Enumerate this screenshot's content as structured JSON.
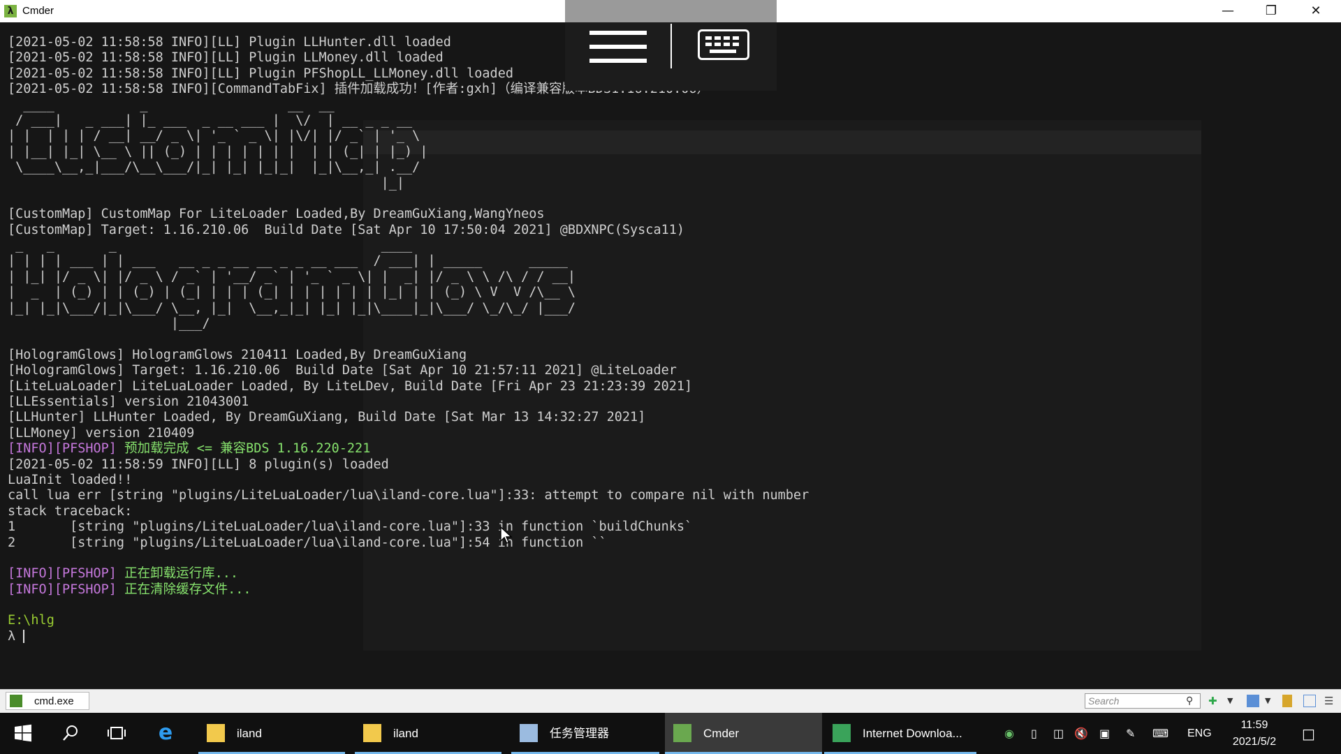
{
  "window": {
    "title": "Cmder",
    "icon": "lambda-icon",
    "controls": [
      "minimize-icon",
      "restore-icon",
      "close-icon"
    ]
  },
  "overlay_toolbar": {
    "icons": [
      "hamburger-menu-icon",
      "keyboard-icon"
    ]
  },
  "console": {
    "lines": [
      "[2021-05-02 11:58:58 INFO][LL] Plugin LLHunter.dll loaded",
      "[2021-05-02 11:58:58 INFO][LL] Plugin LLMoney.dll loaded",
      "[2021-05-02 11:58:58 INFO][LL] Plugin PFShopLL_LLMoney.dll loaded",
      "[2021-05-02 11:58:58 INFO][CommandTabFix] 插件加载成功！[作者:gxh]（编译兼容版本BDS1.16.210.06）",
      "  ____           _                  __  __",
      " / ___|   _ ___| |_ ___  _ __ ___ |  \\/  | __ _ _ __",
      "| |  | | | / __| __/ _ \\| '_ ` _ \\| |\\/| |/ _` | '_ \\",
      "| |__| |_| \\__ \\ || (_) | | | | | | |  | | (_| | |_) |",
      " \\____\\__,_|___/\\__\\___/|_| |_| |_|_|  |_|\\__,_| .__/",
      "                                                |_|",
      "",
      "[CustomMap] CustomMap For LiteLoader Loaded,By DreamGuXiang,WangYneos",
      "[CustomMap] Target: 1.16.210.06  Build Date [Sat Apr 10 17:50:04 2021] @BDXNPC(Sysca11)",
      " _   _       _                                  ____",
      "| | | | ___ | | ___   __ _ _ __ __ _ _ __ ___  / ___| | _____      _____",
      "| |_| |/ _ \\| |/ _ \\ / _` | '__/ _` | '_ ` _ \\| |  _| |/ _ \\ \\ /\\ / / __|",
      "|  _  | (_) | | (_) | (_| | | | (_| | | | | | | |_| | | (_) \\ V  V /\\__ \\",
      "|_| |_|\\___/|_|\\___/ \\__, |_|  \\__,_|_| |_| |_|\\____|_|\\___/ \\_/\\_/ |___/",
      "                     |___/",
      "",
      "[HologramGlows] HologramGlows 210411 Loaded,By DreamGuXiang",
      "[HologramGlows] Target: 1.16.210.06  Build Date [Sat Apr 10 21:57:11 2021] @LiteLoader",
      "[LiteLuaLoader] LiteLuaLoader Loaded, By LiteLDev, Build Date [Fri Apr 23 21:23:39 2021]",
      "[LLEssentials] version 21043001",
      "[LLHunter] LLHunter Loaded, By DreamGuXiang, Build Date [Sat Mar 13 14:32:27 2021]",
      "[LLMoney] version 210409",
      "__PFSHOP1__",
      "[2021-05-02 11:58:59 INFO][LL] 8 plugin(s) loaded",
      "LuaInit loaded!!",
      "call lua err [string \"plugins/LiteLuaLoader/lua\\iland-core.lua\"]:33: attempt to compare nil with number",
      "stack traceback:",
      "1       [string \"plugins/LiteLuaLoader/lua\\iland-core.lua\"]:33 in function `buildChunks`",
      "2       [string \"plugins/LiteLuaLoader/lua\\iland-core.lua\"]:54 in function ``",
      "",
      "__PFSHOP2__",
      "__PFSHOP3__",
      "",
      "__PATH__",
      "__PROMPT__"
    ],
    "pfshop_tag": "[INFO][PFSHOP]",
    "pfshop_msg1": " 预加载完成 <= 兼容BDS 1.16.220-221",
    "pfshop_msg2": " 正在卸载运行库...",
    "pfshop_msg3": " 正在清除缓存文件...",
    "path": "E:\\hlg",
    "prompt": "λ ",
    "colors": {
      "text": "#d0d0d0",
      "tag": "#c678dd",
      "message": "#87e36d",
      "path": "#9acd32"
    }
  },
  "statusbar": {
    "tab_label": "cmd.exe",
    "search_placeholder": "Search",
    "icons": [
      "search-icon",
      "add-console-icon",
      "dropdown-arrow-icon",
      "split-view-icon",
      "lock-icon",
      "toggle-panel-icon",
      "menu-icon"
    ]
  },
  "taskbar": {
    "start_icon": "windows-start-icon",
    "search_icon": "search-icon",
    "task_view_icon": "task-view-icon",
    "browser_icon": "internet-explorer-icon",
    "apps": [
      {
        "label": "iland",
        "icon": "folder-icon",
        "active": false
      },
      {
        "label": "iland",
        "icon": "folder-icon",
        "active": false
      },
      {
        "label": "任务管理器",
        "icon": "task-manager-icon",
        "active": false
      },
      {
        "label": "Cmder",
        "icon": "cmder-icon",
        "active": true
      },
      {
        "label": "Internet Downloa...",
        "icon": "internet-download-manager-icon",
        "active": false
      }
    ],
    "tray": {
      "language": "ENG",
      "icons": [
        "network-globe-icon",
        "tablet-icon",
        "usb-icon",
        "volume-muted-icon",
        "network-icon",
        "pen-icon",
        "keyboard-icon",
        "notification-icon"
      ]
    },
    "clock": {
      "time": "11:59",
      "date": "2021/5/2"
    }
  }
}
